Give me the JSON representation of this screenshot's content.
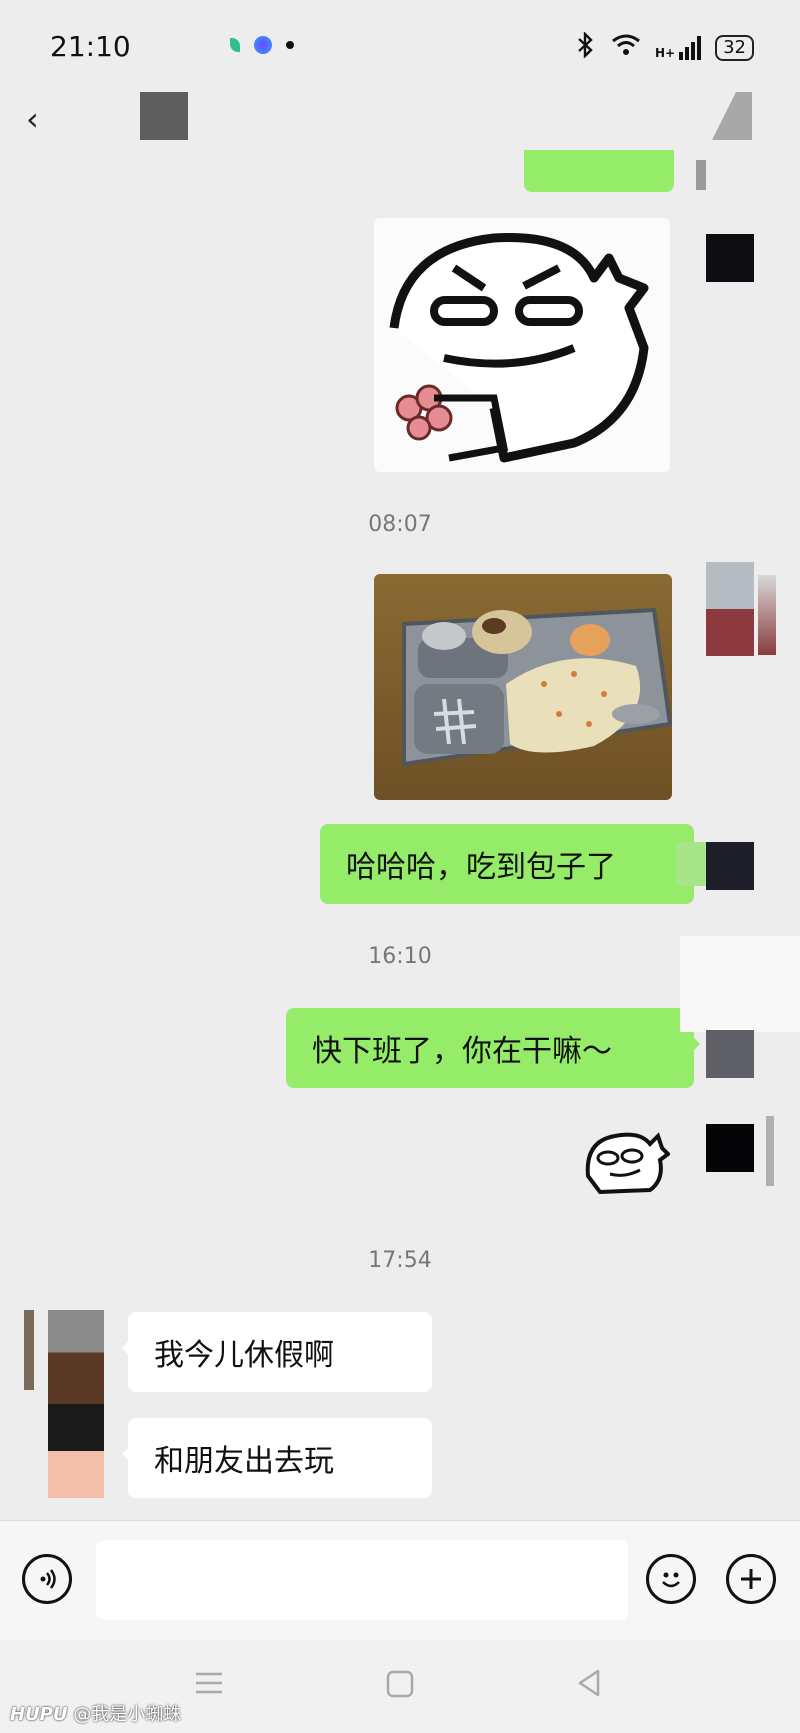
{
  "status_bar": {
    "time": "21:10",
    "battery": "32",
    "network": "H+"
  },
  "header": {
    "back_icon": "‹"
  },
  "messages": {
    "time_1": "08:07",
    "sent_1": "哈哈哈，吃到包子了",
    "time_2": "16:10",
    "sent_2": "快下班了，你在干嘛～",
    "time_3": "17:54",
    "recv_1": "我今儿休假啊",
    "recv_2": "和朋友出去玩"
  },
  "input": {
    "placeholder": ""
  },
  "watermark": {
    "brand": "HUPU",
    "user": "@我是小蜘蛛"
  },
  "colors": {
    "green_bubble": "#95ec69",
    "background": "#ededed"
  },
  "icons": {
    "voice": "voice-icon",
    "emoji": "emoji-icon",
    "plus": "plus-icon",
    "menu": "menu-icon",
    "home": "home-icon",
    "back": "back-icon"
  }
}
